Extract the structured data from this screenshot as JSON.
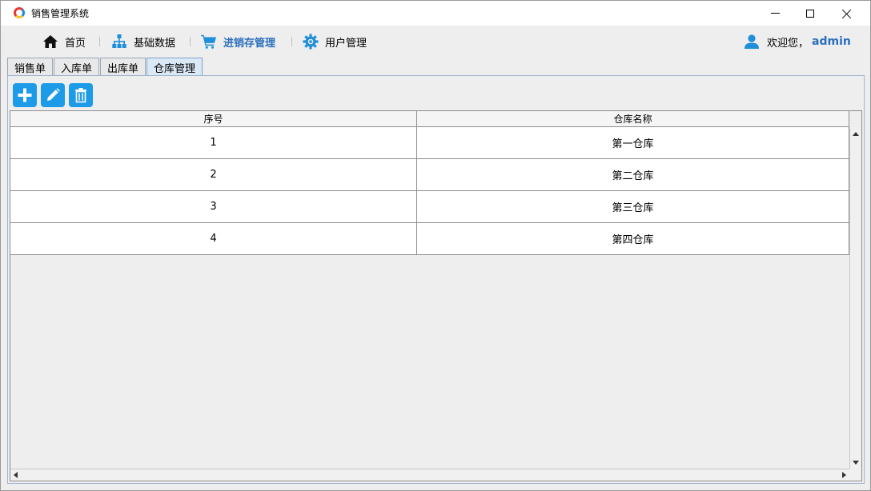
{
  "window": {
    "title": "销售管理系统"
  },
  "menu": {
    "home": "首页",
    "basic_data": "基础数据",
    "inventory": "进销存管理",
    "users": "用户管理",
    "welcome": "欢迎您，",
    "username": "admin"
  },
  "tabs": [
    {
      "label": "销售单"
    },
    {
      "label": "入库单"
    },
    {
      "label": "出库单"
    },
    {
      "label": "仓库管理",
      "active": true
    }
  ],
  "toolbar": {
    "add_icon": "plus-icon",
    "edit_icon": "pencil-icon",
    "delete_icon": "trash-icon"
  },
  "grid": {
    "columns": [
      "序号",
      "仓库名称"
    ],
    "rows": [
      [
        "1",
        "第一仓库"
      ],
      [
        "2",
        "第二仓库"
      ],
      [
        "3",
        "第三仓库"
      ],
      [
        "4",
        "第四仓库"
      ]
    ]
  },
  "colors": {
    "accent": "#2a6fbd",
    "button": "#1e9be8"
  }
}
